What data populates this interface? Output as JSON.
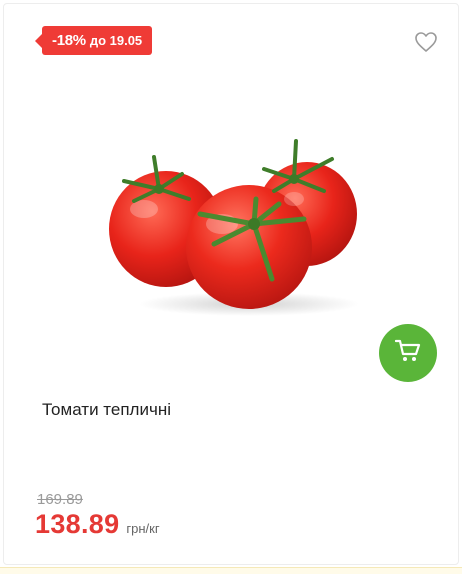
{
  "product": {
    "badge": {
      "discount": "-18%",
      "until": "до 19.05",
      "color": "#ef3b36"
    },
    "favorite_icon": "heart-outline-icon",
    "image_alt": "tomatoes-image",
    "cart_icon": "shopping-cart-icon",
    "cart_button_color": "#5ab539",
    "title": "Томати тепличні",
    "old_price": "169.89",
    "price": "138.89",
    "unit": "грн/кг",
    "price_color": "#e53935"
  }
}
